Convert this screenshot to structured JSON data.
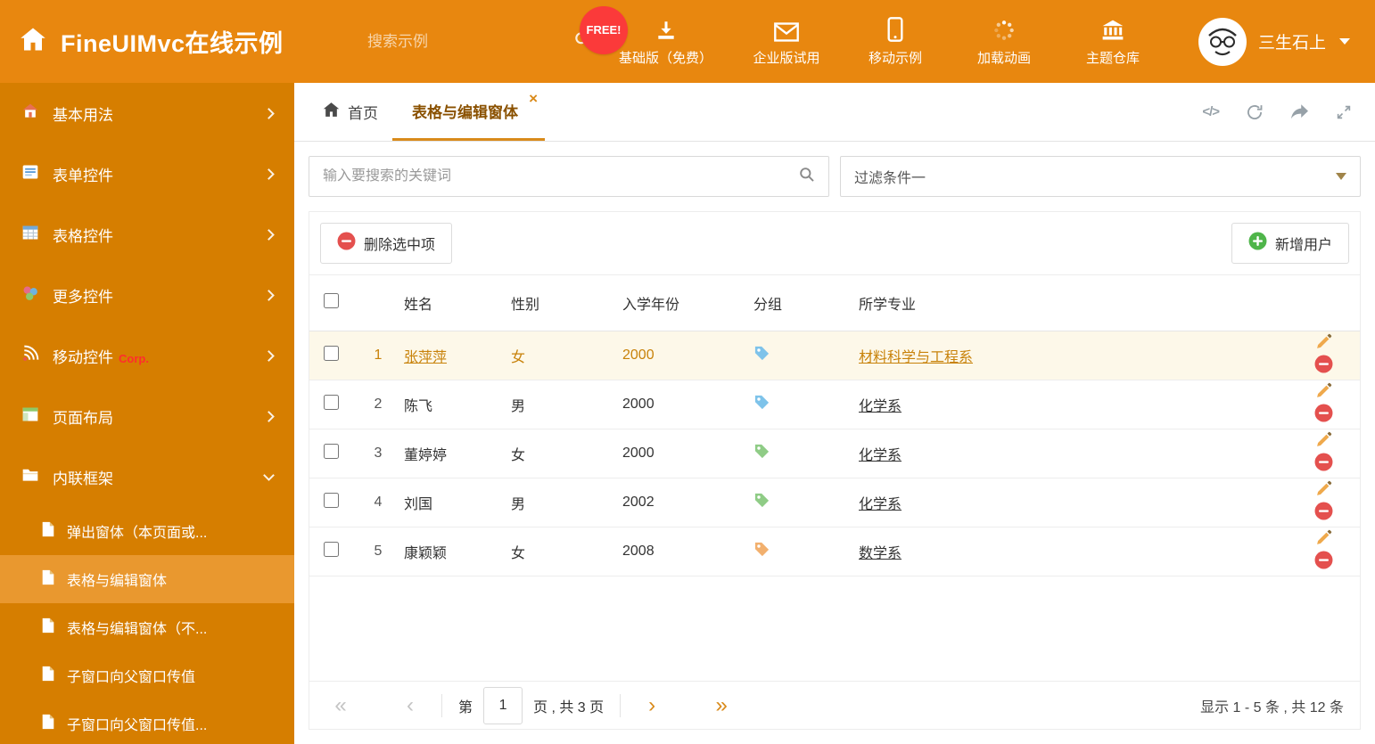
{
  "colors": {
    "header_bg": "#e8870f",
    "sidebar_bg": "#d67e00",
    "accent": "#d98a1a",
    "selected_sidebar": "#e9982f",
    "highlight_row_text": "#c8820a",
    "danger": "#e4504e",
    "success": "#4fb54a"
  },
  "header": {
    "title": "FineUIMvc在线示例",
    "search_placeholder": "搜索示例",
    "free_badge": "FREE!",
    "nav": [
      {
        "label": "基础版（免费）",
        "icon": "download-icon"
      },
      {
        "label": "企业版试用",
        "icon": "envelope-icon"
      },
      {
        "label": "移动示例",
        "icon": "mobile-icon"
      },
      {
        "label": "加载动画",
        "icon": "spinner-icon"
      },
      {
        "label": "主题仓库",
        "icon": "bank-icon"
      }
    ],
    "user": "三生石上"
  },
  "sidebar": {
    "items": [
      {
        "label": "基本用法",
        "icon": "home-icon"
      },
      {
        "label": "表单控件",
        "icon": "form-icon"
      },
      {
        "label": "表格控件",
        "icon": "grid-icon"
      },
      {
        "label": "更多控件",
        "icon": "circles-icon"
      },
      {
        "label": "移动控件",
        "badge": "Corp.",
        "icon": "signal-icon"
      },
      {
        "label": "页面布局",
        "icon": "layout-icon"
      },
      {
        "label": "内联框架",
        "icon": "folder-icon"
      }
    ],
    "subitems": [
      {
        "label": "弹出窗体（本页面或..."
      },
      {
        "label": "表格与编辑窗体",
        "active": true
      },
      {
        "label": "表格与编辑窗体（不..."
      },
      {
        "label": "子窗口向父窗口传值"
      },
      {
        "label": "子窗口向父窗口传值..."
      }
    ]
  },
  "tabs": {
    "home": "首页",
    "active": "表格与编辑窗体"
  },
  "filter": {
    "search_placeholder": "输入要搜索的关键词",
    "dropdown_value": "过滤条件一"
  },
  "toolbar": {
    "delete_label": "删除选中项",
    "add_label": "新增用户"
  },
  "table": {
    "headers": [
      "姓名",
      "性别",
      "入学年份",
      "分组",
      "所学专业"
    ],
    "rows": [
      {
        "num": "1",
        "name": "张萍萍",
        "gender": "女",
        "year": "2000",
        "tag": "blue",
        "major": "材料科学与工程系",
        "highlight": true
      },
      {
        "num": "2",
        "name": "陈飞",
        "gender": "男",
        "year": "2000",
        "tag": "blue",
        "major": "化学系"
      },
      {
        "num": "3",
        "name": "董婷婷",
        "gender": "女",
        "year": "2000",
        "tag": "green",
        "major": "化学系"
      },
      {
        "num": "4",
        "name": "刘国",
        "gender": "男",
        "year": "2002",
        "tag": "green",
        "major": "化学系"
      },
      {
        "num": "5",
        "name": "康颖颖",
        "gender": "女",
        "year": "2008",
        "tag": "orange",
        "major": "数学系"
      }
    ]
  },
  "pagination": {
    "page_prefix": "第",
    "page_value": "1",
    "page_suffix": "页 , 共 3 页",
    "summary": "显示 1 - 5 条 , 共 12 条"
  }
}
